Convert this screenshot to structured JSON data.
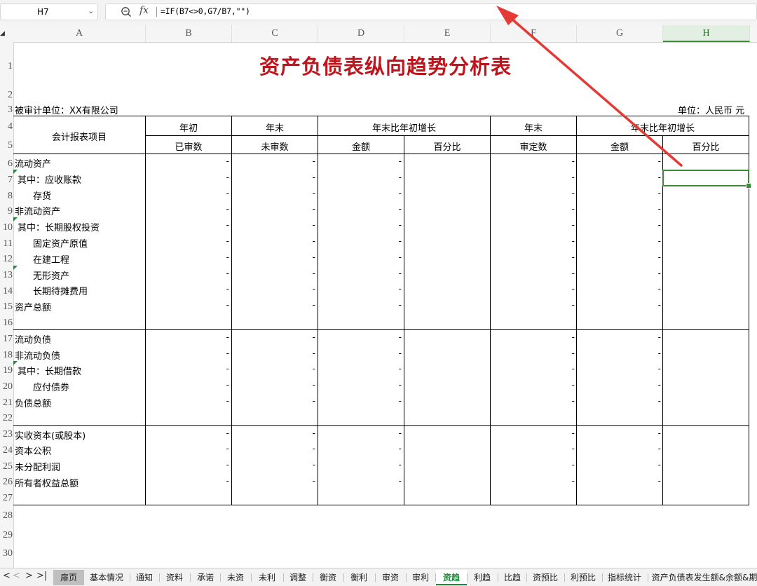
{
  "formula_bar": {
    "cell_ref": "H7",
    "formula": "=IF(B7<>0,G7/B7,\"\")",
    "icons": [
      "zoom-icon",
      "fx-icon",
      "chevron-down-icon"
    ]
  },
  "columns": [
    "A",
    "B",
    "C",
    "D",
    "E",
    "F",
    "G",
    "H"
  ],
  "selected_column": "H",
  "rows": [
    "1",
    "2",
    "3",
    "4",
    "5",
    "6",
    "7",
    "8",
    "9",
    "10",
    "11",
    "12",
    "13",
    "14",
    "15",
    "16",
    "17",
    "18",
    "19",
    "20",
    "21",
    "22",
    "23",
    "24",
    "25",
    "26",
    "27",
    "28",
    "29",
    "30"
  ],
  "sheet": {
    "title": "资产负债表纵向趋势分析表",
    "entity": "被审计单位：XX有限公司",
    "unit": "单位：人民币 元",
    "header": {
      "item": "会计报表项目",
      "group_start": "年初",
      "group_end": "年末",
      "group_growth1": "年末比年初增长",
      "group_end2": "年末",
      "group_growth2": "年末比年初增长",
      "audited": "已审数",
      "unaudited": "未审数",
      "amount1": "金额",
      "pct1": "百分比",
      "approved": "审定数",
      "amount2": "金额",
      "pct2": "百分比"
    },
    "items": [
      "流动资产",
      "其中：应收账款",
      "存货",
      "非流动资产",
      "其中：长期股权投资",
      "固定资产原值",
      "在建工程",
      "无形资产",
      "长期待摊费用",
      "资产总额",
      "流动负债",
      "非流动负债",
      "其中：长期借款",
      "应付债券",
      "负债总额",
      "实收资本(或股本)",
      "资本公积",
      "未分配利润",
      "所有者权益总额"
    ],
    "dash": "-"
  },
  "tabs": {
    "nav": [
      "<",
      ">",
      ">|"
    ],
    "items": [
      "扉页",
      "基本情况",
      "通知",
      "资料",
      "承诺",
      "未资",
      "未利",
      "调整",
      "衡资",
      "衡利",
      "审资",
      "审利",
      "资趋",
      "利趋",
      "比趋",
      "资预比",
      "利预比",
      "指标统计",
      "资产负债表发生额&余额&期"
    ],
    "home": "扉页",
    "active": "资趋"
  },
  "colors": {
    "title": "#c0141c",
    "accent": "#3a8a3a",
    "arrow": "#e53935"
  }
}
